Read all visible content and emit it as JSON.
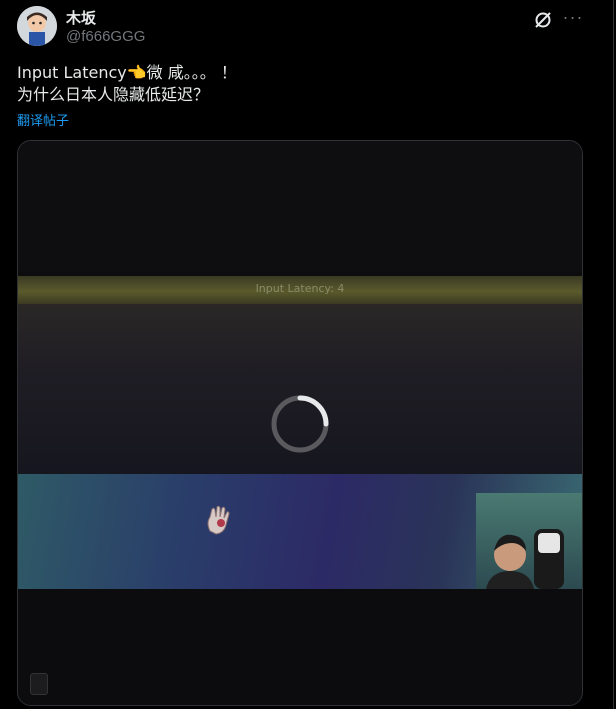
{
  "author": {
    "display_name": "木坂",
    "handle": "@f666GGG"
  },
  "actions": {
    "grok_icon": "grok-icon",
    "more_icon": "more-icon",
    "more_glyph": "···"
  },
  "post": {
    "line1": "Input Latency👈微 咸。。。 ！",
    "line2": "为什么日本人隐藏低延迟？",
    "translate_label": "翻译帖子"
  },
  "media": {
    "overlay_text": "Input Latency: 4",
    "state": "loading"
  }
}
